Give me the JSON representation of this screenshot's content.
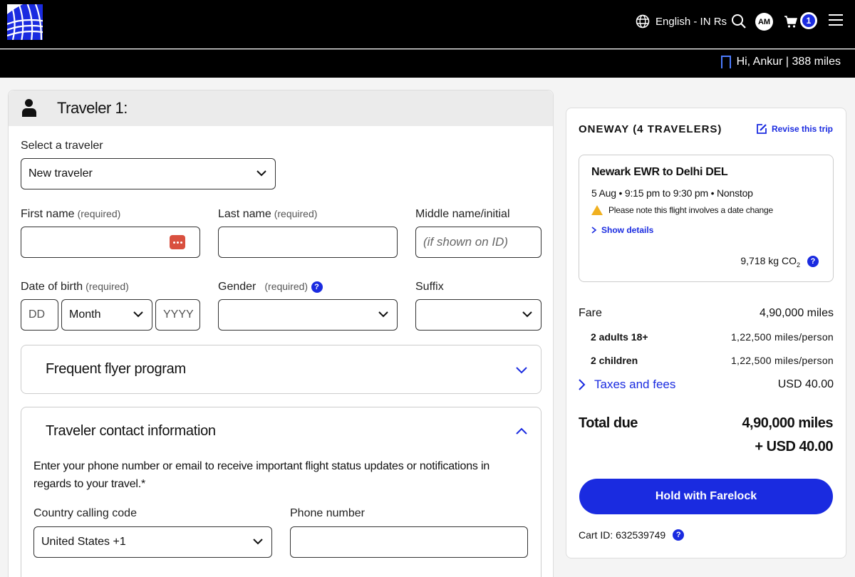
{
  "header": {
    "language": "English - IN Rs",
    "avatar_initials": "AM",
    "cart_count": "1",
    "greeting": "Hi, Ankur | 388 miles"
  },
  "traveler": {
    "title": "Traveler 1:",
    "select_label": "Select a traveler",
    "select_value": "New traveler",
    "first_name_label": "First name",
    "last_name_label": "Last name",
    "middle_name_label": "Middle name/initial",
    "middle_name_placeholder": "(if shown on ID)",
    "required": "(required)",
    "dob_label": "Date of birth",
    "dob_day_placeholder": "DD",
    "dob_month_value": "Month",
    "dob_year_placeholder": "YYYY",
    "gender_label": "Gender",
    "suffix_label": "Suffix",
    "help": "?"
  },
  "frequent_flyer": {
    "title": "Frequent flyer program"
  },
  "contact": {
    "title": "Traveler contact information",
    "description": "Enter your phone number or email to receive important flight status updates or notifications in regards to your travel.*",
    "country_code_label": "Country calling code",
    "country_code_value": "United States +1",
    "phone_label": "Phone number"
  },
  "summary": {
    "title": "ONEWAY (4 TRAVELERS)",
    "revise": "Revise this trip",
    "route": "Newark EWR to Delhi DEL",
    "times": "5 Aug • 9:15 pm to 9:30 pm • Nonstop",
    "warning": "Please note this flight involves a date change",
    "show_details": "Show details",
    "co2_value": "9,718 kg CO",
    "co2_sub": "2",
    "fare_label": "Fare",
    "fare_value": "4,90,000 miles",
    "adults_label": "2 adults 18+",
    "adults_value": "1,22,500 miles/person",
    "children_label": "2 children",
    "children_value": "1,22,500 miles/person",
    "taxes_label": "Taxes and fees",
    "taxes_value": "USD 40.00",
    "total_label": "Total due",
    "total_miles": "4,90,000 miles",
    "total_usd": "+ USD 40.00",
    "hold_button": "Hold with Farelock",
    "cart_id": "Cart ID: 632539749"
  },
  "colors": {
    "brand_blue": "#1a2be0",
    "header_bg": "#000000",
    "warning": "#f0b020",
    "autofill": "#d9503f"
  }
}
